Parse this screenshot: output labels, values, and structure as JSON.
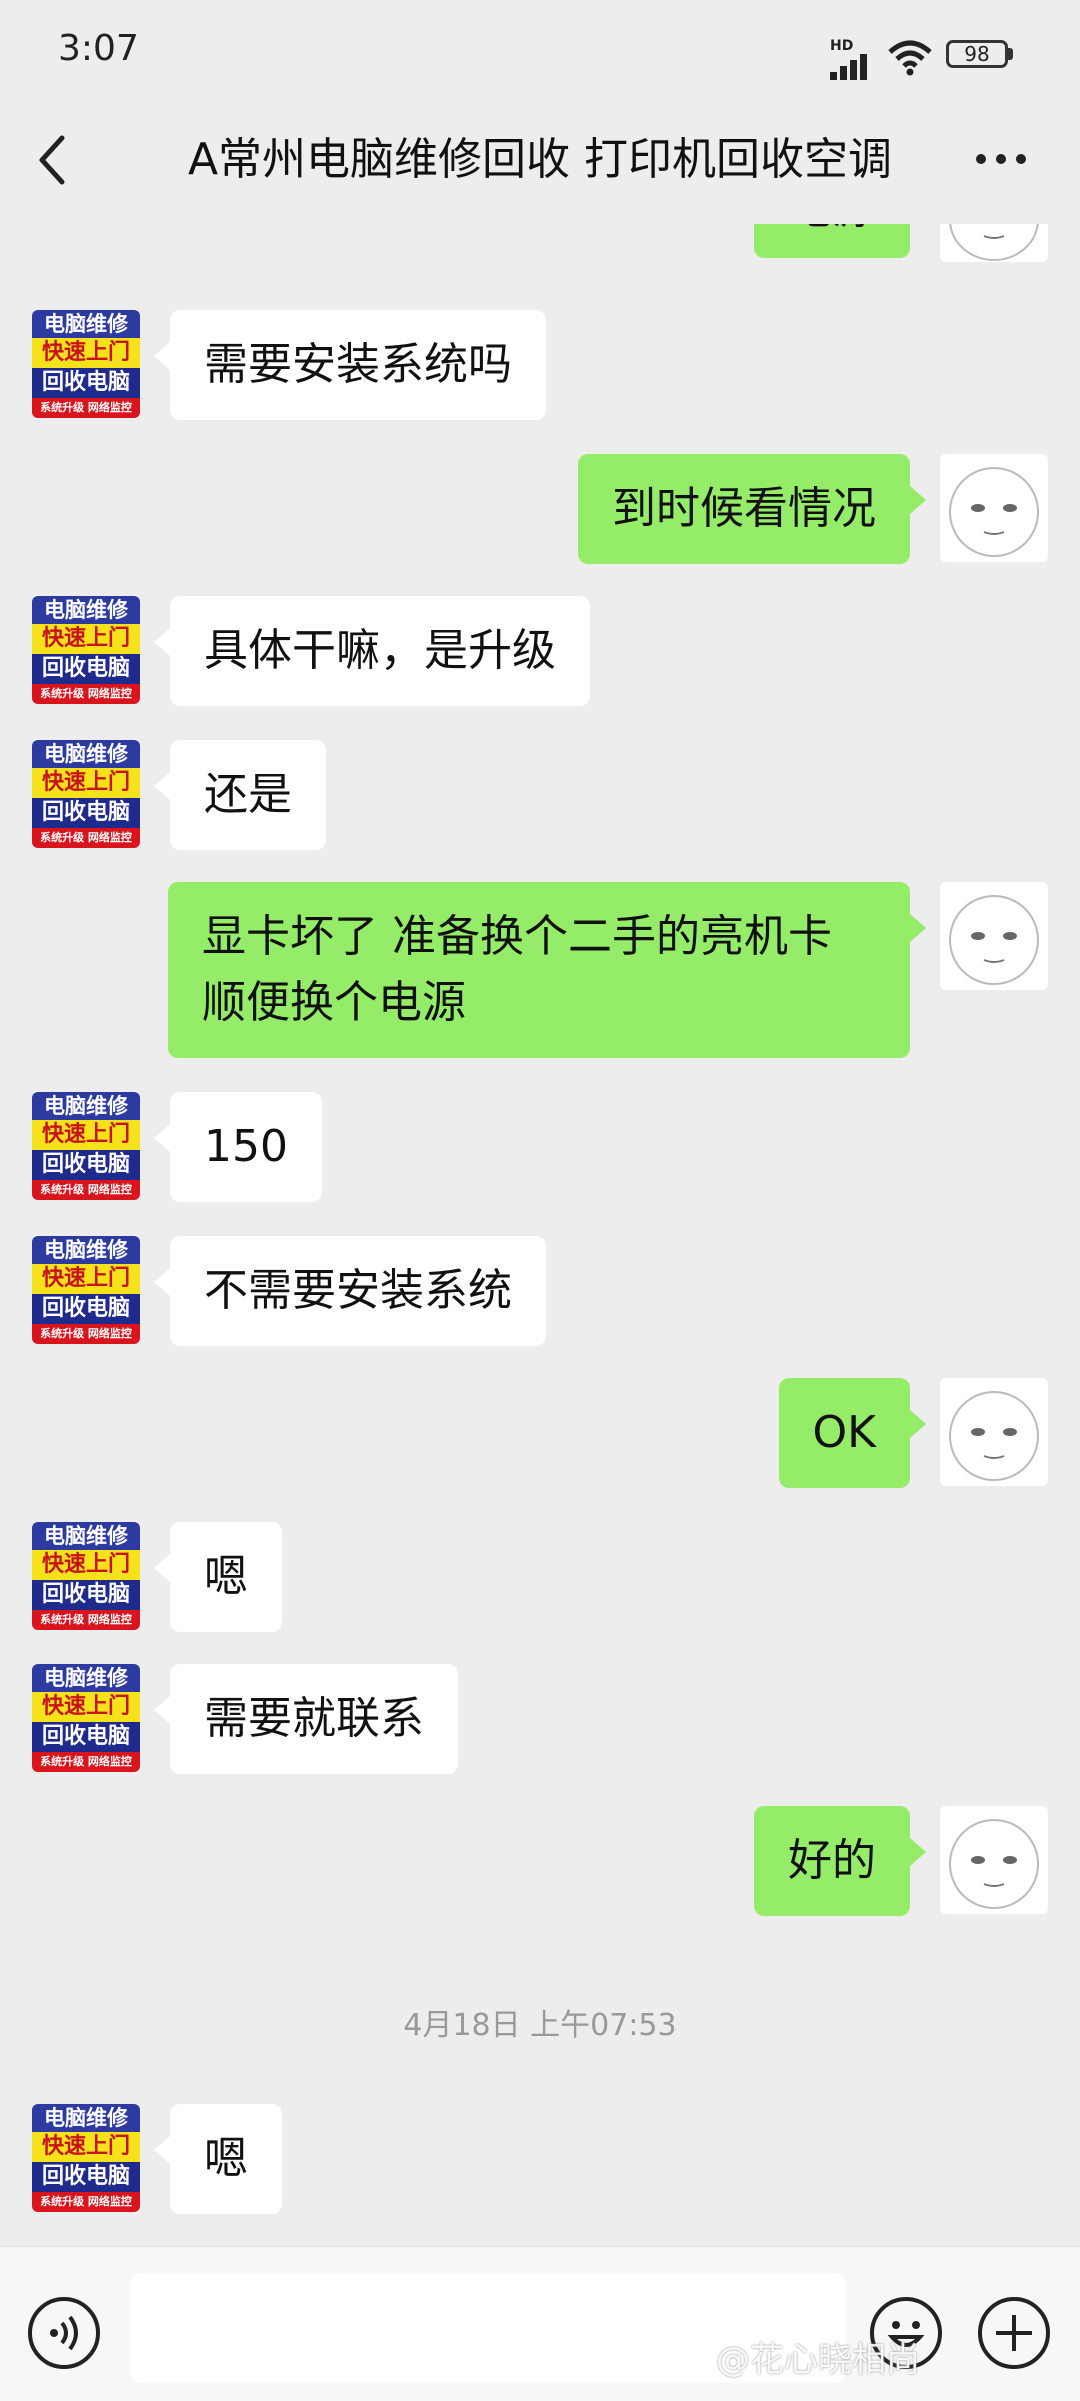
{
  "status_bar": {
    "time": "3:07",
    "network": "HD",
    "battery": "98"
  },
  "header": {
    "title": "A常州电脑维修回收 打印机回收空调"
  },
  "shop_avatar": {
    "line1": "电脑维修",
    "line2": "快速上门",
    "line3": "回收电脑",
    "line4": "系统升级 网络监控"
  },
  "messages": [
    {
      "sender": "me",
      "text": "电源"
    },
    {
      "sender": "shop",
      "text": "需要安装系统吗"
    },
    {
      "sender": "me",
      "text": "到时候看情况"
    },
    {
      "sender": "shop",
      "text": "具体干嘛，是升级"
    },
    {
      "sender": "shop",
      "text": "还是"
    },
    {
      "sender": "me",
      "line1": "显卡坏了  准备换个二手的亮机卡",
      "line2": "顺便换个电源"
    },
    {
      "sender": "shop",
      "text": "150"
    },
    {
      "sender": "shop",
      "text": "不需要安装系统"
    },
    {
      "sender": "me",
      "text": "OK"
    },
    {
      "sender": "shop",
      "text": "嗯"
    },
    {
      "sender": "shop",
      "text": "需要就联系"
    },
    {
      "sender": "me",
      "text": "好的"
    },
    {
      "sender": "shop",
      "text": "嗯"
    }
  ],
  "timestamp": "4月18日 上午07:53",
  "watermark": "@花心晓相尚",
  "icons": {
    "back": "chevron-left-icon",
    "more": "more-dots-icon",
    "voice": "voice-icon",
    "emoji": "emoji-icon",
    "plus": "plus-icon"
  }
}
